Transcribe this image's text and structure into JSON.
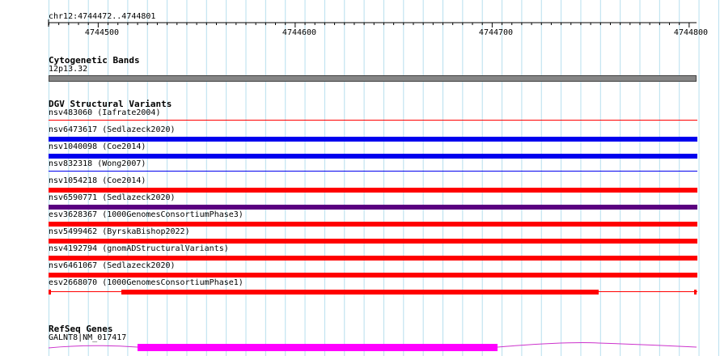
{
  "ruler": {
    "position_label": "chr12:4744472..4744801",
    "ticks": [
      "4744500",
      "4744600",
      "4744700",
      "4744800"
    ]
  },
  "cytobands": {
    "title": "Cytogenetic Bands",
    "band_label": "12p13.32",
    "band_color": "#858585"
  },
  "dgv": {
    "title": "DGV Structural Variants",
    "colors": {
      "loss": "#ff0000",
      "gain": "#0000ee",
      "both": "#5a0080"
    },
    "variants": [
      {
        "label": "nsv483060 (Iafrate2004)",
        "kind": "loss",
        "style": "thin"
      },
      {
        "label": "nsv6473617 (Sedlazeck2020)",
        "kind": "gain",
        "style": "thick"
      },
      {
        "label": "nsv1040098 (Coe2014)",
        "kind": "gain",
        "style": "thick"
      },
      {
        "label": "nsv832318 (Wong2007)",
        "kind": "gain",
        "style": "thin"
      },
      {
        "label": "nsv1054218 (Coe2014)",
        "kind": "loss",
        "style": "thick"
      },
      {
        "label": "nsv6590771 (Sedlazeck2020)",
        "kind": "both",
        "style": "thick"
      },
      {
        "label": "esv3628367 (1000GenomesConsortiumPhase3)",
        "kind": "loss",
        "style": "thick"
      },
      {
        "label": "nsv5499462 (ByrskaBishop2022)",
        "kind": "loss",
        "style": "thick"
      },
      {
        "label": "nsv4192794 (gnomADStructuralVariants)",
        "kind": "loss",
        "style": "thick"
      },
      {
        "label": "nsv6461067 (Sedlazeck2020)",
        "kind": "loss",
        "style": "thick"
      },
      {
        "label": "esv2668070 (1000GenomesConsortiumPhase1)",
        "kind": "loss",
        "style": "segmented"
      }
    ]
  },
  "refseq": {
    "title": "RefSeq Genes",
    "gene_label": "GALNT8|NM_017417",
    "exon_color": "#ff00ff",
    "intron_color": "#cc33cc"
  }
}
